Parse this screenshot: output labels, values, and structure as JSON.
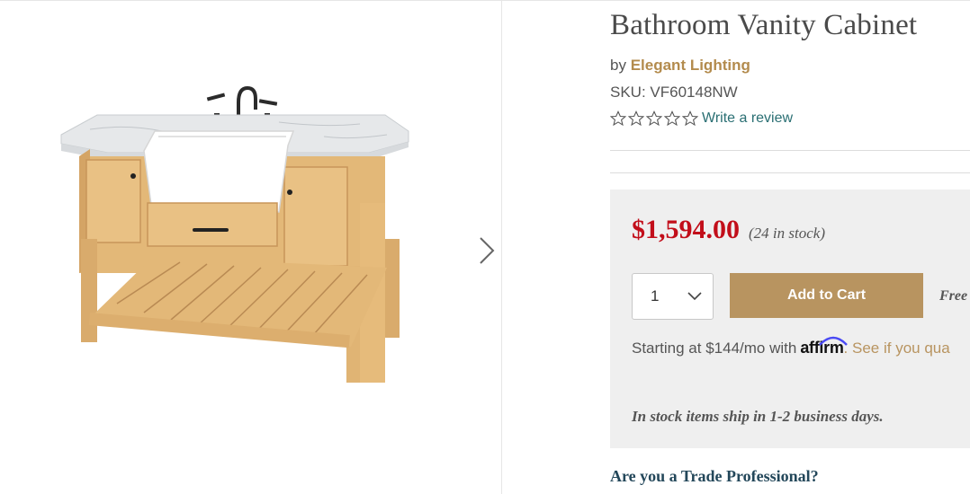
{
  "product": {
    "title": "Bathroom Vanity Cabinet",
    "by_prefix": "by",
    "brand": "Elegant Lighting",
    "sku": "SKU: VF60148NW",
    "rating_stars": 0,
    "rating_max": 5,
    "write_review_label": "Write a review"
  },
  "gallery": {
    "next_icon": "chevron-right-icon"
  },
  "buy_box": {
    "price": "$1,594.00",
    "stock_text": "(24 in stock)",
    "quantity": "1",
    "add_to_cart_label": "Add to Cart",
    "free_shipping_text": "Free",
    "financing_text": "Starting at $144/mo with",
    "affirm_label": "affirm",
    "financing_link": ". See if you qua",
    "ship_note": "In stock items ship in 1-2 business days."
  },
  "trade": {
    "label": "Are you a Trade Professional?"
  },
  "colors": {
    "price": "#c20e1a",
    "brand": "#b38b4d",
    "cart_button": "#b89460",
    "review_link": "#2a6f73",
    "trade_heading": "#23475a",
    "buy_box_bg": "#efefef"
  }
}
